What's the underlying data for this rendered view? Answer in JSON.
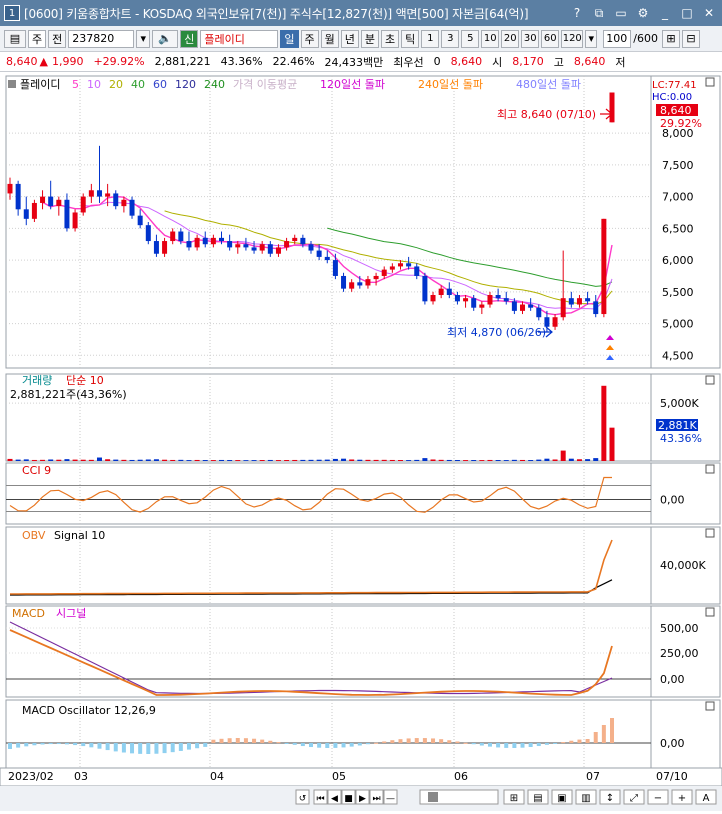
{
  "window": {
    "app_icon": "1",
    "title": "[0600] 키움종합차트 - KOSDAQ 외국인보유[7(천)] 주식수[12,827(천)] 액면[500] 자본금[64(억)]",
    "buttons": [
      "help-icon",
      "link-icon",
      "restore-icon",
      "settings-icon",
      "minimize-icon",
      "maximize-icon",
      "close-icon"
    ]
  },
  "toolbar": {
    "market": "주",
    "prev": "전",
    "code": "237820",
    "stock_badge": "신",
    "stock_name": "플레이디",
    "periods": [
      "일",
      "주",
      "월",
      "년",
      "분",
      "초",
      "틱"
    ],
    "active_period": "일",
    "intervals": [
      "1",
      "3",
      "5",
      "10",
      "20",
      "30",
      "60",
      "120"
    ],
    "count_value": "100",
    "count_total": "/600"
  },
  "info": {
    "price": "8,640",
    "change": "1,990",
    "change_pct": "+29.92%",
    "volume": "2,881,221",
    "vol_ratio": "43.36%",
    "turnover": "22.46%",
    "amount": "24,433백만",
    "pref_label": "최우선",
    "pref_value": "0",
    "price2": "8,640",
    "open_label": "시",
    "open_value": "8,170",
    "low_label": "고",
    "low_value": "8,640",
    "high_label": "저"
  },
  "price_panel": {
    "legend_stock": "플레이디",
    "legend_ma": [
      "5",
      "10",
      "20",
      "40",
      "60",
      "120",
      "240"
    ],
    "legend_ma_colors": [
      "#ff3ac8",
      "#cc66ff",
      "#b0b000",
      "#2e9e2e",
      "#3344cc",
      "#2d2d9a",
      "#1f8f1f"
    ],
    "legend_extra": [
      "가격 이동평균",
      "120일선 돌파",
      "240일선 돌파",
      "480일선 돌파"
    ],
    "legend_extra_colors": [
      "#c8b0c8",
      "#d000d0",
      "#ff8000",
      "#8080ff"
    ],
    "lc": "LC:77.41",
    "hc": "HC:0.00",
    "last_price": "8,640",
    "last_pct": "29.92%",
    "high_note": "최고 8,640 (07/10)",
    "low_note": "최저 4,870 (06/26)",
    "y_ticks": [
      "8,000",
      "7,500",
      "7,000",
      "6,500",
      "6,000",
      "5,500",
      "5,000",
      "4,500"
    ]
  },
  "volume_panel": {
    "title": "거래량",
    "ma_label": "단순 10",
    "value": "2,881,221주(43,36%)",
    "y_ticks": [
      "5,000K"
    ],
    "last_value": "2,881K",
    "last_pct": "43.36%"
  },
  "cci_panel": {
    "title": "CCI 9",
    "y_ticks": [
      "0,00"
    ]
  },
  "obv_panel": {
    "title": "OBV",
    "signal": "Signal 10",
    "y_ticks": [
      "40,000K"
    ]
  },
  "macd_panel": {
    "title": "MACD",
    "signal": "시그널",
    "y_ticks": [
      "500,00",
      "250,00",
      "0,00"
    ]
  },
  "osc_panel": {
    "title": "MACD Oscillator 12,26,9",
    "y_ticks": [
      "0,00"
    ]
  },
  "x_axis": [
    "2023/02",
    "03",
    "04",
    "05",
    "06",
    "07",
    "07/10"
  ],
  "colors": {
    "up": "#e60012",
    "down": "#0033cc",
    "ma5": "#ff3ac8",
    "ma20": "#b0b000",
    "ma60": "#2e9e2e",
    "ma120": "#1f8f1f",
    "ma240": "#3344cc",
    "orange": "#e87722",
    "purple": "#7a2ea0"
  },
  "chart_data": {
    "type": "candlestick",
    "price_range": [
      4300,
      8900
    ],
    "candles": [
      [
        7050,
        7300,
        6950,
        7200
      ],
      [
        7200,
        7250,
        6700,
        6800
      ],
      [
        6800,
        7000,
        6550,
        6650
      ],
      [
        6650,
        6950,
        6600,
        6900
      ],
      [
        6900,
        7100,
        6800,
        7000
      ],
      [
        7000,
        7250,
        6800,
        6850
      ],
      [
        6850,
        7000,
        6700,
        6950
      ],
      [
        6950,
        7050,
        6450,
        6500
      ],
      [
        6500,
        6800,
        6450,
        6750
      ],
      [
        6750,
        7050,
        6700,
        7000
      ],
      [
        7000,
        7200,
        6900,
        7100
      ],
      [
        7100,
        7800,
        6900,
        7000
      ],
      [
        7000,
        7200,
        6850,
        7050
      ],
      [
        7050,
        7100,
        6800,
        6850
      ],
      [
        6850,
        7000,
        6750,
        6950
      ],
      [
        6950,
        7000,
        6650,
        6700
      ],
      [
        6700,
        6800,
        6500,
        6550
      ],
      [
        6550,
        6600,
        6250,
        6300
      ],
      [
        6300,
        6400,
        6050,
        6100
      ],
      [
        6100,
        6350,
        6050,
        6300
      ],
      [
        6300,
        6500,
        6250,
        6450
      ],
      [
        6450,
        6500,
        6250,
        6300
      ],
      [
        6300,
        6450,
        6150,
        6200
      ],
      [
        6200,
        6400,
        6150,
        6350
      ],
      [
        6350,
        6450,
        6200,
        6250
      ],
      [
        6250,
        6400,
        6200,
        6350
      ],
      [
        6350,
        6450,
        6250,
        6300
      ],
      [
        6300,
        6400,
        6150,
        6200
      ],
      [
        6200,
        6300,
        6100,
        6250
      ],
      [
        6250,
        6350,
        6150,
        6200
      ],
      [
        6200,
        6300,
        6100,
        6150
      ],
      [
        6150,
        6300,
        6100,
        6250
      ],
      [
        6250,
        6300,
        6050,
        6100
      ],
      [
        6100,
        6250,
        6050,
        6200
      ],
      [
        6200,
        6350,
        6150,
        6300
      ],
      [
        6300,
        6400,
        6250,
        6350
      ],
      [
        6350,
        6400,
        6200,
        6250
      ],
      [
        6250,
        6300,
        6100,
        6150
      ],
      [
        6150,
        6250,
        6000,
        6050
      ],
      [
        6050,
        6150,
        5950,
        6000
      ],
      [
        6000,
        6100,
        5700,
        5750
      ],
      [
        5750,
        5800,
        5500,
        5550
      ],
      [
        5550,
        5700,
        5500,
        5650
      ],
      [
        5650,
        5750,
        5550,
        5600
      ],
      [
        5600,
        5750,
        5550,
        5700
      ],
      [
        5700,
        5800,
        5600,
        5750
      ],
      [
        5750,
        5900,
        5700,
        5850
      ],
      [
        5850,
        5950,
        5800,
        5900
      ],
      [
        5900,
        6000,
        5850,
        5950
      ],
      [
        5950,
        6050,
        5850,
        5900
      ],
      [
        5900,
        5950,
        5700,
        5750
      ],
      [
        5750,
        5800,
        5300,
        5350
      ],
      [
        5350,
        5500,
        5300,
        5450
      ],
      [
        5450,
        5600,
        5400,
        5550
      ],
      [
        5550,
        5650,
        5400,
        5450
      ],
      [
        5450,
        5500,
        5300,
        5350
      ],
      [
        5350,
        5450,
        5250,
        5400
      ],
      [
        5400,
        5450,
        5200,
        5250
      ],
      [
        5250,
        5350,
        5150,
        5300
      ],
      [
        5300,
        5500,
        5250,
        5450
      ],
      [
        5450,
        5550,
        5350,
        5400
      ],
      [
        5400,
        5500,
        5300,
        5350
      ],
      [
        5350,
        5400,
        5150,
        5200
      ],
      [
        5200,
        5350,
        5150,
        5300
      ],
      [
        5300,
        5400,
        5200,
        5250
      ],
      [
        5250,
        5300,
        5050,
        5100
      ],
      [
        5100,
        5200,
        4870,
        4950
      ],
      [
        4950,
        5150,
        4900,
        5100
      ],
      [
        5100,
        6150,
        5050,
        5400
      ],
      [
        5400,
        5500,
        5250,
        5300
      ],
      [
        5300,
        5450,
        5250,
        5400
      ],
      [
        5400,
        5500,
        5300,
        5350
      ],
      [
        5350,
        5450,
        5100,
        5150
      ],
      [
        5150,
        6650,
        5100,
        6650
      ],
      [
        8170,
        8640,
        8170,
        8640
      ]
    ],
    "volume": [
      180,
      120,
      140,
      90,
      100,
      130,
      110,
      160,
      120,
      110,
      100,
      300,
      150,
      120,
      100,
      90,
      110,
      130,
      150,
      110,
      90,
      100,
      80,
      90,
      85,
      80,
      90,
      85,
      80,
      75,
      80,
      85,
      90,
      80,
      85,
      90,
      95,
      100,
      110,
      120,
      180,
      200,
      130,
      110,
      100,
      95,
      100,
      90,
      85,
      80,
      95,
      250,
      130,
      100,
      90,
      85,
      80,
      85,
      80,
      90,
      85,
      80,
      100,
      90,
      85,
      120,
      200,
      130,
      900,
      200,
      150,
      160,
      250,
      6500,
      2881
    ],
    "volume_unit": "천주"
  }
}
